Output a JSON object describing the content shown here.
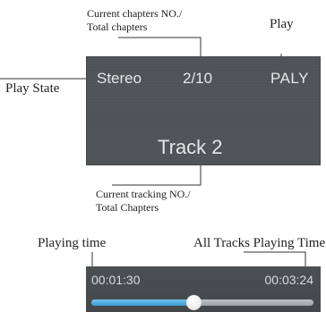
{
  "annotations": {
    "chapters_line1": "Current chapters NO./",
    "chapters_line2": "Total chapters",
    "play": "Play",
    "play_state": "Play State",
    "tracking_line1": "Current tracking NO./",
    "tracking_line2": "Total Chapters",
    "playing_time": "Playing time",
    "all_tracks_time": "All Tracks Playing Time"
  },
  "screen": {
    "mode": "Stereo",
    "chapter": "2/10",
    "play_status": "PALY",
    "track": "Track 2"
  },
  "player": {
    "elapsed": "00:01:30",
    "total": "00:03:24",
    "progress": 0.46
  },
  "colors": {
    "screen_bg": "#505457",
    "screen_text": "#e4e6e8",
    "progress_fill": "#3a9ad6"
  }
}
